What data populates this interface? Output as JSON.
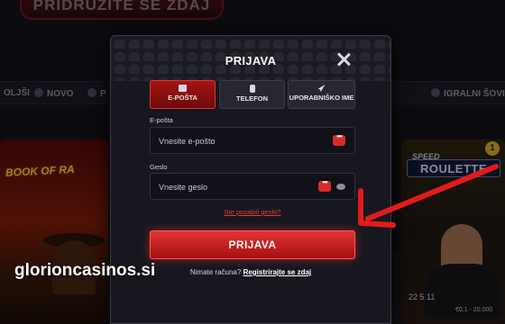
{
  "background": {
    "banner_text": "PRIDRUŽITE SE ZDAJ",
    "nav_items": [
      {
        "label": "OLJŠI",
        "icon": "star-icon"
      },
      {
        "label": "NOVO",
        "icon": "lightning-icon"
      },
      {
        "label": "P",
        "icon": "flag-icon"
      },
      {
        "label": "IGRALNI ŠOVI",
        "icon": "mic-icon"
      }
    ],
    "left_tile": {
      "logo_text": "BOOK OF RA"
    },
    "right_tile": {
      "badge": "1",
      "speed_label": "SPEED",
      "title": "ROULETTE",
      "numbers": "22 5 11",
      "limits": "€0,1 - 20.000"
    }
  },
  "modal": {
    "title": "PRIJAVA",
    "tabs": [
      {
        "label": "E-POŠTA",
        "icon": "envelope-icon",
        "active": true
      },
      {
        "label": "TELEFON",
        "icon": "phone-icon",
        "active": false
      },
      {
        "label": "UPORABNIŠKO IME",
        "icon": "rocket-icon",
        "active": false
      }
    ],
    "email": {
      "label": "E-pošta",
      "placeholder": "Vnesite e-pošto",
      "value": ""
    },
    "password": {
      "label": "Geslo",
      "placeholder": "Vnesite geslo",
      "value": ""
    },
    "forgot_link": "Ste pozabili geslo?",
    "submit_label": "PRIJAVA",
    "signup_text": "Nimate računa?",
    "signup_link": "Registrirajte se zdaj"
  },
  "watermark": "glorioncasinos.si",
  "colors": {
    "accent": "#e23434",
    "arrow": "#e21b1b",
    "modal_bg": "#17181f"
  }
}
